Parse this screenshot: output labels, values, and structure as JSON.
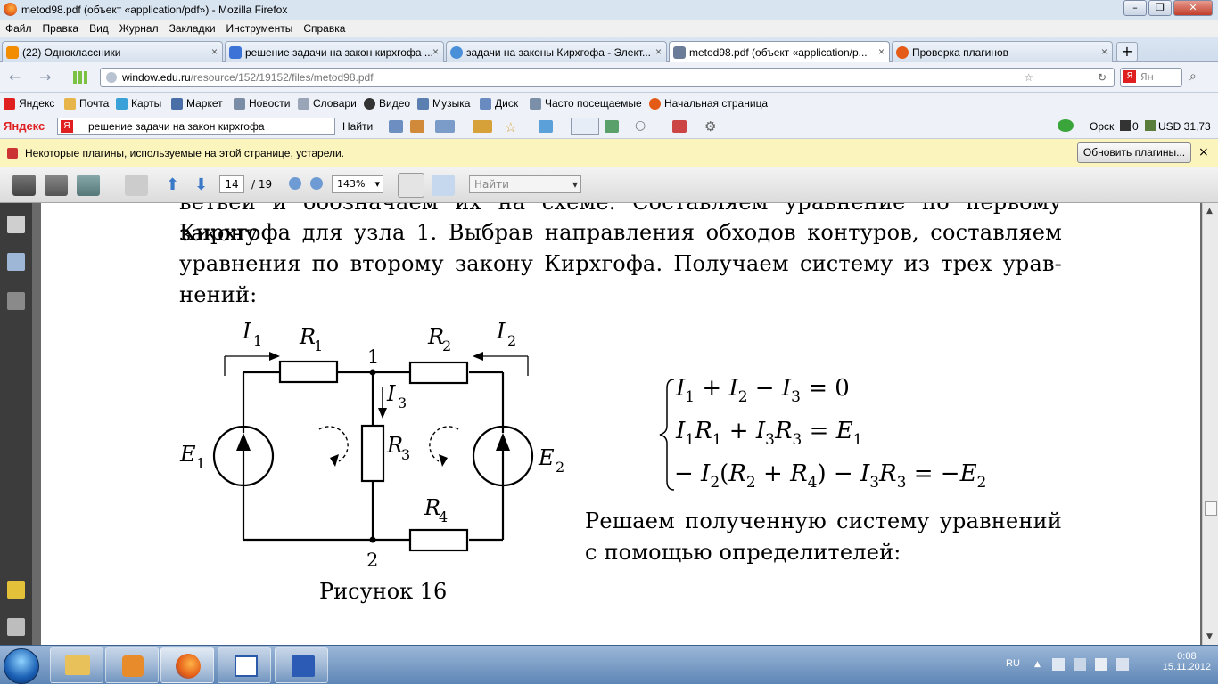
{
  "window": {
    "title": "metod98.pdf (объект «application/pdf») - Mozilla Firefox"
  },
  "menu": [
    "Файл",
    "Правка",
    "Вид",
    "Журнал",
    "Закладки",
    "Инструменты",
    "Справка"
  ],
  "tabs": [
    {
      "label": "(22) Одноклассники",
      "color": "#f28c00"
    },
    {
      "label": "решение задачи на закон кирхгофа ...",
      "color": "#3b73d6"
    },
    {
      "label": "задачи на законы Кирхгофа - Элект...",
      "color": "#4a90d9"
    },
    {
      "label": "metod98.pdf (объект «application/p...",
      "color": "#6b7c99"
    },
    {
      "label": "Проверка плагинов",
      "color": "#e35b16"
    }
  ],
  "new_tab_label": "+",
  "url": {
    "host": "window.edu.ru",
    "path": "/resource/152/19152/files/metod98.pdf"
  },
  "search_engine": {
    "label": "Я",
    "placeholder": "Ян"
  },
  "bookmarks": [
    "Яндекс",
    "Почта",
    "Карты",
    "Маркет",
    "Новости",
    "Словари",
    "Видео",
    "Музыка",
    "Диск",
    "Часто посещаемые",
    "Начальная страница"
  ],
  "yandex_bar": {
    "brand": "Яндекс",
    "query": "решение задачи на закон кирхгофа",
    "find_label": "Найти",
    "city": "Орск",
    "mail_count": "0",
    "currency": "USD 31,73"
  },
  "notification": {
    "message": "Некоторые плагины, используемые на этой странице, устарели.",
    "button": "Обновить плагины...",
    "close": "×"
  },
  "pdf_toolbar": {
    "page": "14",
    "total": "/ 19",
    "zoom": "143%",
    "find_placeholder": "Найти"
  },
  "document": {
    "line0": "ветвей и обозначаем их на схеме. Составляем уравнение по первому закону",
    "para1": "Кирхгофа для узла 1. Выбрав направления обходов контуров, составляем уравнения по второму закону Кирхгофа. Получаем систему из трех урав-нений:",
    "figure_caption": "Рисунок 16",
    "para2": "Решаем полученную систему уравнений с помощью определителей:",
    "node1": "1",
    "node2": "2"
  },
  "taskbar": {
    "lang": "RU",
    "time": "0:08",
    "date": "15.11.2012"
  }
}
